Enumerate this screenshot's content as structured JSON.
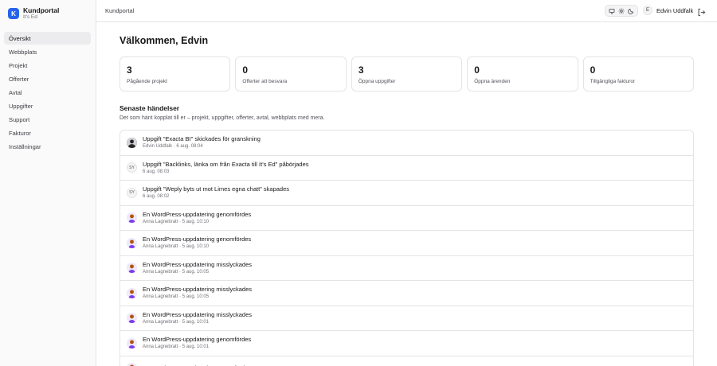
{
  "brand": {
    "initial": "K",
    "name": "Kundportal",
    "subtitle": "It's Ed"
  },
  "nav": [
    {
      "label": "Översikt",
      "active": true
    },
    {
      "label": "Webbplats"
    },
    {
      "label": "Projekt"
    },
    {
      "label": "Offerter"
    },
    {
      "label": "Avtal"
    },
    {
      "label": "Uppgifter"
    },
    {
      "label": "Support"
    },
    {
      "label": "Fakturor"
    },
    {
      "label": "Inställningar"
    }
  ],
  "topbar": {
    "breadcrumb": "Kundportal",
    "theme_icons": [
      "monitor-icon",
      "sun-icon",
      "moon-icon"
    ],
    "user_initial": "E",
    "user_name": "Edvin Uddfalk",
    "logout_icon": "logout-icon"
  },
  "page": {
    "title": "Välkommen, Edvin"
  },
  "stats": [
    {
      "value": "3",
      "label": "Pågående projekt"
    },
    {
      "value": "0",
      "label": "Offerter att besvara"
    },
    {
      "value": "3",
      "label": "Öppna uppgifter"
    },
    {
      "value": "0",
      "label": "Öppna ärenden"
    },
    {
      "value": "0",
      "label": "Tillgängliga fakturor"
    }
  ],
  "events_section": {
    "title": "Senaste händelser",
    "subtitle": "Det som hänt kopplat till er – projekt, uppgifter, offerter, avtal, webbplats med mera."
  },
  "events": [
    {
      "avatar": "dark",
      "title": "Uppgift \"Exacta BI\" skickades för granskning",
      "meta": "Edvin Uddfalk · 6 aug. 08:04"
    },
    {
      "avatar": "system",
      "initials": "SY",
      "title": "Uppgift \"Backlinks, länka om från Exacta till It's Ed\" påbörjades",
      "meta": "6 aug. 08:03"
    },
    {
      "avatar": "system",
      "initials": "SY",
      "title": "Uppgift \"Weply byts ut mot Limes egna chatt\" skapades",
      "meta": "6 aug. 08:02"
    },
    {
      "avatar": "person",
      "title": "En WordPress-uppdatering genomfördes",
      "meta": "Anna Lagnebratt · 5 aug. 10:10"
    },
    {
      "avatar": "person",
      "title": "En WordPress-uppdatering genomfördes",
      "meta": "Anna Lagnebratt · 5 aug. 10:10"
    },
    {
      "avatar": "person",
      "title": "En WordPress-uppdatering misslyckades",
      "meta": "Anna Lagnebratt · 5 aug. 10:05"
    },
    {
      "avatar": "person",
      "title": "En WordPress-uppdatering misslyckades",
      "meta": "Anna Lagnebratt · 5 aug. 10:05"
    },
    {
      "avatar": "person",
      "title": "En WordPress-uppdatering misslyckades",
      "meta": "Anna Lagnebratt · 5 aug. 10:01"
    },
    {
      "avatar": "person",
      "title": "En WordPress-uppdatering genomfördes",
      "meta": "Anna Lagnebratt · 5 aug. 10:01"
    },
    {
      "avatar": "person",
      "title": "En WordPress-uppdatering genomfördes",
      "meta": ""
    }
  ],
  "colors": {
    "brand": "#2563eb",
    "border": "#e4e4e7",
    "sidebar_bg": "#fafafa"
  }
}
